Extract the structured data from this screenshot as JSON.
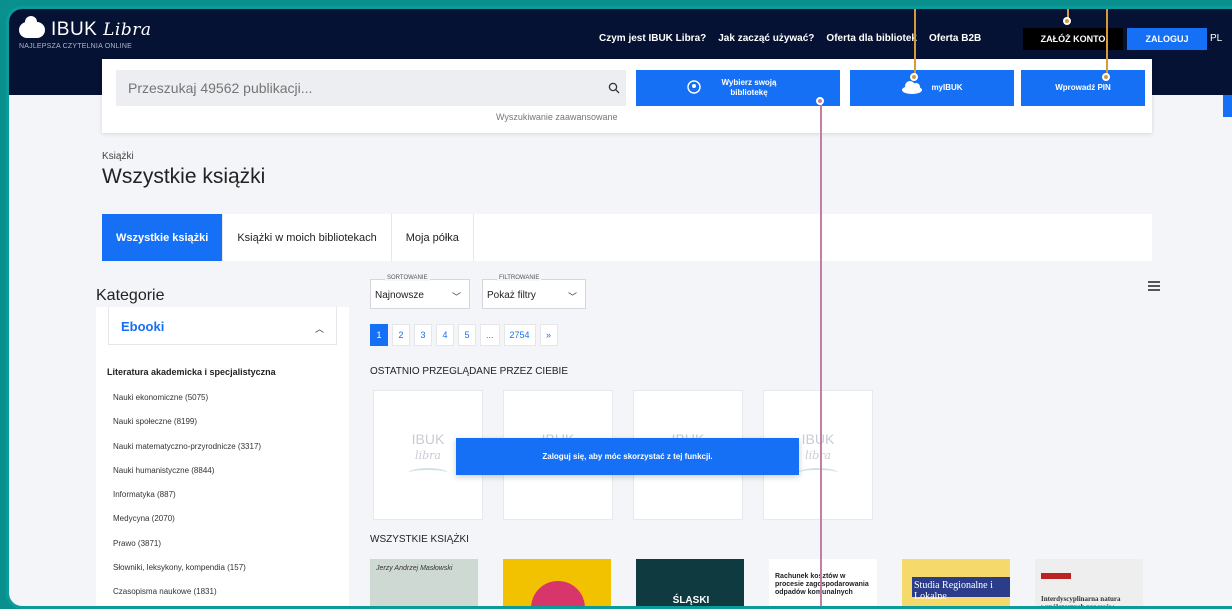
{
  "brand": {
    "name": "IBUK",
    "script": "Libra",
    "tagline": "NAJLEPSZA CZYTELNIA ONLINE"
  },
  "nav": {
    "items": [
      "Czym jest IBUK Libra?",
      "Jak zacząć używać?",
      "Oferta dla bibliotek",
      "Oferta B2B"
    ],
    "create_account": "ZAŁÓŻ KONTO",
    "login": "ZALOGUJ",
    "lang": "PL"
  },
  "search": {
    "placeholder": "Przeszukaj 49562 publikacji...",
    "advanced": "Wyszukiwanie zaawansowane",
    "choose_library": "Wybierz swoją bibliotekę",
    "myibuk": "myIBUK",
    "enter_pin": "Wprowadź PIN"
  },
  "breadcrumb": "Książki",
  "page_title": "Wszystkie książki",
  "tabs": [
    "Wszystkie książki",
    "Książki w moich bibliotekach",
    "Moja półka"
  ],
  "sidebar": {
    "title": "Kategorie",
    "ebooks": "Ebooki",
    "section": "Literatura akademicka i specjalistyczna",
    "items": [
      "Nauki ekonomiczne (5075)",
      "Nauki społeczne (8199)",
      "Nauki matematyczno-przyrodnicze (3317)",
      "Nauki humanistyczne (8844)",
      "Informatyka (887)",
      "Medycyna (2070)",
      "Prawo (3871)",
      "Słowniki, leksykony, kompendia (157)",
      "Czasopisma naukowe (1831)"
    ]
  },
  "sorting": {
    "caption": "SORTOWANIE",
    "value": "Najnowsze"
  },
  "filtering": {
    "caption": "FILTROWANIE",
    "value": "Pokaż filtry"
  },
  "pagination": [
    "1",
    "2",
    "3",
    "4",
    "5",
    "...",
    "2754",
    "»"
  ],
  "recent": {
    "heading": "OSTATNIO PRZEGLĄDANE PRZEZ CIEBIE",
    "placeholder_brand": "IBUK",
    "placeholder_script": "libra",
    "login_prompt": "Zaloguj się, aby móc skorzystać z tej funkcji."
  },
  "all_books": {
    "heading": "WSZYSTKIE KSIĄŻKI",
    "covers": [
      {
        "text": "Jerzy Andrzej Masłowski",
        "bg": "#cfd9d4",
        "fg": "#333333"
      },
      {
        "text": "",
        "bg": "#f2c200",
        "fg": "#222222"
      },
      {
        "text": "ŚLĄSKI PRZEGLĄD STATYSTYCZNY",
        "bg": "#0f3a3f",
        "fg": "#ffffff"
      },
      {
        "text": "Rachunek kosztów w procesie zagospodarowania odpadów komunalnych",
        "bg": "#ffffff",
        "fg": "#222222"
      },
      {
        "text": "Studia Regionalne i Lokalne",
        "bg": "#f6d96b",
        "fg": "#ffffff"
      },
      {
        "text": "Interdyscyplinarna natura współczesnych procesów",
        "bg": "#eeeeee",
        "fg": "#333333"
      }
    ]
  },
  "colors": {
    "primary": "#1570f5",
    "topbar": "#061233",
    "frame": "#0c9b9b"
  }
}
